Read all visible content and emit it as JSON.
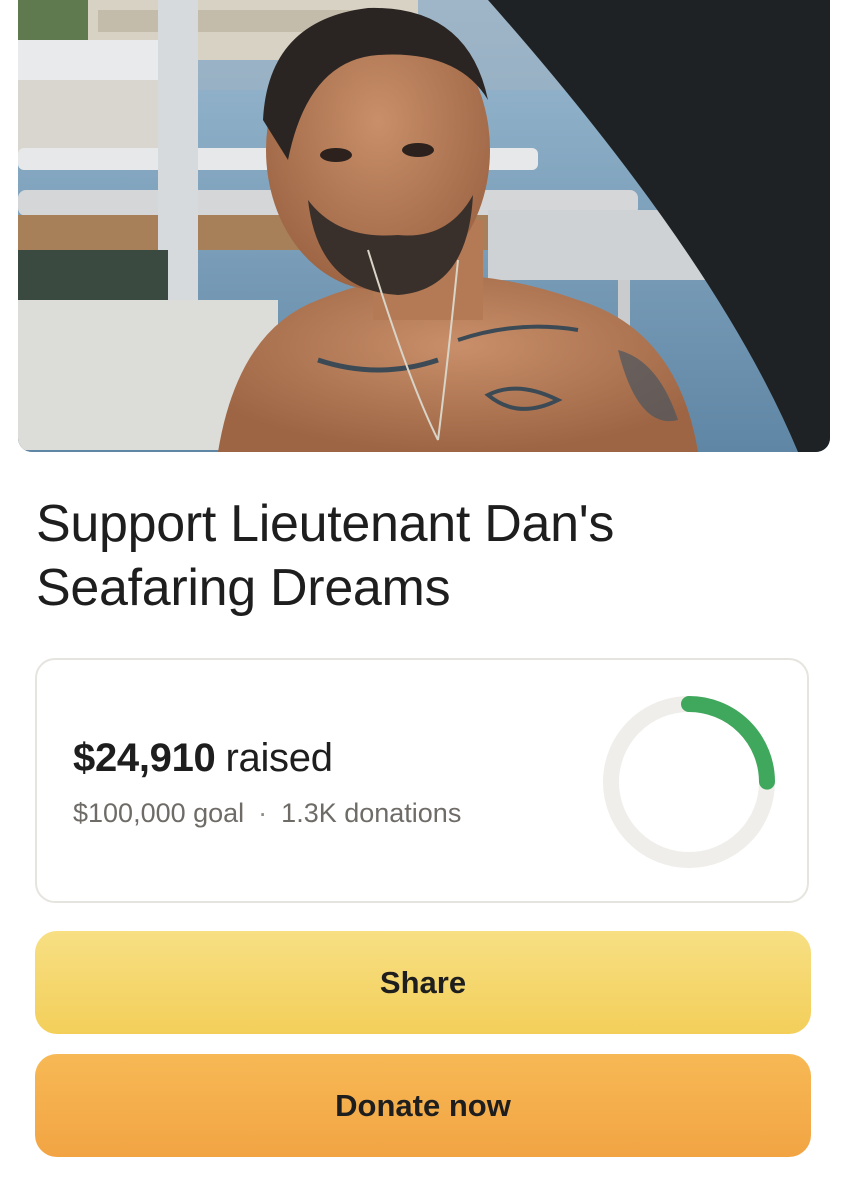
{
  "campaign": {
    "title": "Support Lieutenant Dan's Seafaring Dreams"
  },
  "progress": {
    "raised_amount": "$24,910",
    "raised_word": "raised",
    "goal_text": "$100,000 goal",
    "separator": "·",
    "donations_text": "1.3K donations",
    "fraction": 0.2491,
    "ring_color": "#3fa85c",
    "track_color": "#efeeea"
  },
  "actions": {
    "share_label": "Share",
    "donate_label": "Donate now"
  },
  "colors": {
    "share_button": "#f5d66e",
    "donate_button": "#f4ae4c"
  }
}
